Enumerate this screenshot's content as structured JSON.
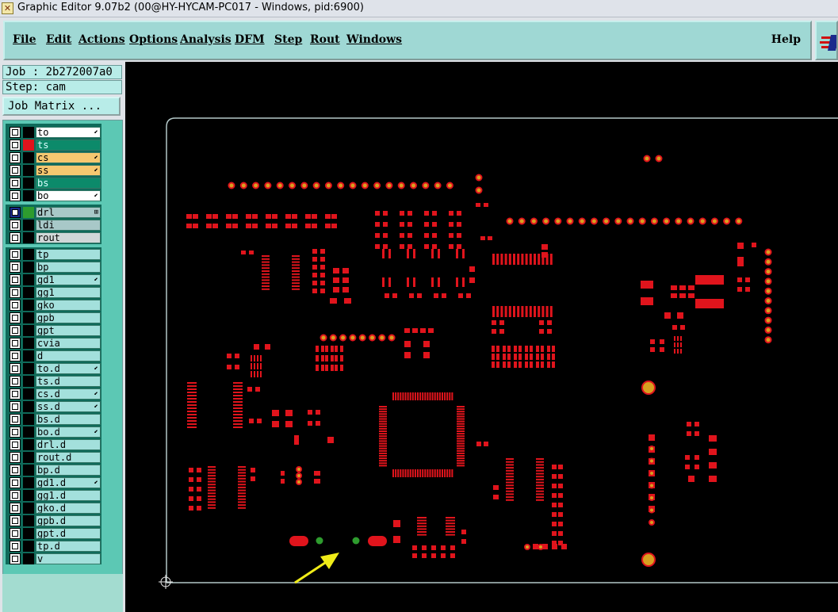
{
  "window": {
    "title": "Graphic Editor 9.07b2 (00@HY-HYCAM-PC017 - Windows, pid:6900)"
  },
  "menu": {
    "items": [
      {
        "label": "File"
      },
      {
        "label": "Edit"
      },
      {
        "label": "Actions"
      },
      {
        "label": "Options"
      },
      {
        "label": "Analysis"
      },
      {
        "label": "DFM"
      },
      {
        "label": "Step"
      },
      {
        "label": "Rout"
      },
      {
        "label": "Windows"
      }
    ],
    "help": "Help"
  },
  "job": {
    "label": "Job : 2b272007a0",
    "step": "Step: cam",
    "matrix_button": "Job Matrix ..."
  },
  "layers": [
    {
      "name": "to",
      "swatch": "#000000",
      "bg": "#ffffff",
      "arrow": "⬋"
    },
    {
      "name": "ts",
      "swatch": "#e0141c",
      "bg": "#0c8a6a",
      "arrow": ""
    },
    {
      "name": "cs",
      "swatch": "#000000",
      "bg": "#f6c870",
      "arrow": "⬋"
    },
    {
      "name": "ss",
      "swatch": "#000000",
      "bg": "#f6c870",
      "arrow": "⬋"
    },
    {
      "name": "bs",
      "swatch": "#000000",
      "bg": "#0c8a6a",
      "arrow": ""
    },
    {
      "name": "bo",
      "swatch": "#000000",
      "bg": "#ffffff",
      "arrow": "⬋"
    },
    {
      "name": "drl",
      "swatch": "#2e9c2e",
      "bg": "#a8c8c8",
      "arrow": "⊞"
    },
    {
      "name": "ldi",
      "swatch": "#000000",
      "bg": "#a8c8c8",
      "arrow": ""
    },
    {
      "name": "rout",
      "swatch": "#000000",
      "bg": "#d0d8d8",
      "arrow": ""
    },
    {
      "name": "tp",
      "swatch": "#000000",
      "bg": "#a3e0dc",
      "arrow": ""
    },
    {
      "name": "bp",
      "swatch": "#000000",
      "bg": "#a3e0dc",
      "arrow": ""
    },
    {
      "name": "gd1",
      "swatch": "#000000",
      "bg": "#a3e0dc",
      "arrow": "⬋"
    },
    {
      "name": "gg1",
      "swatch": "#000000",
      "bg": "#a3e0dc",
      "arrow": ""
    },
    {
      "name": "gko",
      "swatch": "#000000",
      "bg": "#a3e0dc",
      "arrow": ""
    },
    {
      "name": "gpb",
      "swatch": "#000000",
      "bg": "#a3e0dc",
      "arrow": ""
    },
    {
      "name": "gpt",
      "swatch": "#000000",
      "bg": "#a3e0dc",
      "arrow": ""
    },
    {
      "name": "cvia",
      "swatch": "#000000",
      "bg": "#a3e0dc",
      "arrow": ""
    },
    {
      "name": "d",
      "swatch": "#000000",
      "bg": "#a3e0dc",
      "arrow": ""
    },
    {
      "name": "to.d",
      "swatch": "#000000",
      "bg": "#a3e0dc",
      "arrow": "⬋"
    },
    {
      "name": "ts.d",
      "swatch": "#000000",
      "bg": "#a3e0dc",
      "arrow": ""
    },
    {
      "name": "cs.d",
      "swatch": "#000000",
      "bg": "#a3e0dc",
      "arrow": "⬋"
    },
    {
      "name": "ss.d",
      "swatch": "#000000",
      "bg": "#a3e0dc",
      "arrow": "⬋"
    },
    {
      "name": "bs.d",
      "swatch": "#000000",
      "bg": "#a3e0dc",
      "arrow": ""
    },
    {
      "name": "bo.d",
      "swatch": "#000000",
      "bg": "#a3e0dc",
      "arrow": "⬋"
    },
    {
      "name": "drl.d",
      "swatch": "#000000",
      "bg": "#a3e0dc",
      "arrow": ""
    },
    {
      "name": "rout.d",
      "swatch": "#000000",
      "bg": "#a3e0dc",
      "arrow": ""
    },
    {
      "name": "bp.d",
      "swatch": "#000000",
      "bg": "#a3e0dc",
      "arrow": ""
    },
    {
      "name": "gd1.d",
      "swatch": "#000000",
      "bg": "#a3e0dc",
      "arrow": "⬋"
    },
    {
      "name": "gg1.d",
      "swatch": "#000000",
      "bg": "#a3e0dc",
      "arrow": ""
    },
    {
      "name": "gko.d",
      "swatch": "#000000",
      "bg": "#a3e0dc",
      "arrow": ""
    },
    {
      "name": "gpb.d",
      "swatch": "#000000",
      "bg": "#a3e0dc",
      "arrow": ""
    },
    {
      "name": "gpt.d",
      "swatch": "#000000",
      "bg": "#a3e0dc",
      "arrow": ""
    },
    {
      "name": "tp.d",
      "swatch": "#000000",
      "bg": "#a3e0dc",
      "arrow": ""
    },
    {
      "name": "v",
      "swatch": "#000000",
      "bg": "#a3e0dc",
      "arrow": ""
    }
  ],
  "colors": {
    "pad": "#e0141c",
    "pad_dark": "#b00c12",
    "drill_ring": "#d8a020",
    "drill_green": "#2e9c2e",
    "outline": "#b4c8c8",
    "arrow": "#f0ec18",
    "menu_bg": "#9fd8d4",
    "panel_bg": "#5cc8b4"
  }
}
